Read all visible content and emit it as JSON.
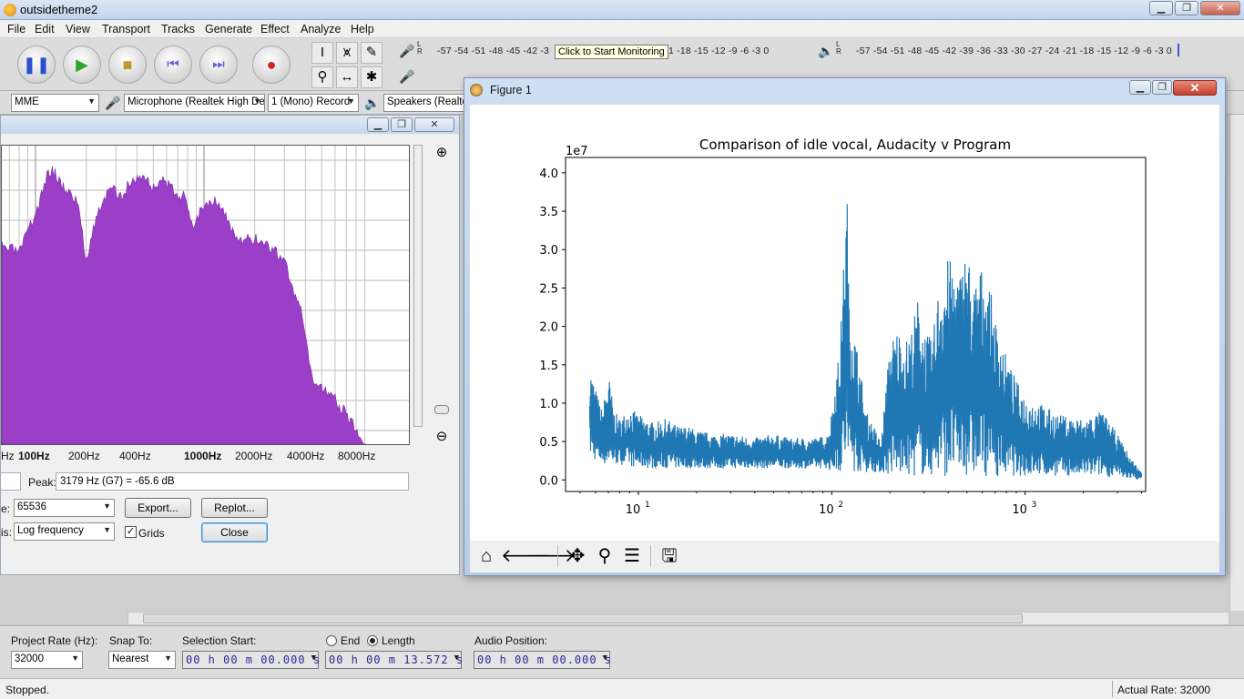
{
  "window": {
    "title": "outsidetheme2"
  },
  "menu": [
    "File",
    "Edit",
    "View",
    "Transport",
    "Tracks",
    "Generate",
    "Effect",
    "Analyze",
    "Help"
  ],
  "meters": {
    "record_scale": "-57 -54 -51 -48 -45 -42 -3",
    "record_scale_tail": "21 -18 -15 -12  -9  -6  -3  0",
    "playback_scale": "-57 -54 -51 -48 -45 -42 -39 -36 -33 -30 -27 -24 -21 -18 -15 -12  -9  -6  -3  0",
    "record_lr": "L\nR",
    "tooltip": "Click to Start Monitoring"
  },
  "devices": {
    "host": "MME",
    "input": "Microphone (Realtek High De",
    "channels": "1 (Mono) Record",
    "output": "Speakers (Realte"
  },
  "spectrum": {
    "x_ticks": [
      "Hz",
      "100Hz",
      "200Hz",
      "400Hz",
      "1000Hz",
      "2000Hz",
      "4000Hz",
      "8000Hz"
    ],
    "peak_label": "Peak:",
    "peak_value": "3179 Hz (G7) = -65.6 dB",
    "size_label": "e:",
    "size_value": "65536",
    "axis_label": "is:",
    "axis_value": "Log frequency",
    "export_label": "Export...",
    "replot_label": "Replot...",
    "grids_label": "Grids",
    "grids_checked": "✓",
    "close_label": "Close",
    "fill_color": "#9b3fc8"
  },
  "figure": {
    "title": "Figure 1",
    "close_glyph": "✕"
  },
  "chart_data": {
    "type": "line",
    "title": "Comparison of idle vocal, Audacity v Program",
    "offset_label": "1e7",
    "xscale": "log",
    "xlim": [
      4.2,
      4200
    ],
    "ylim": [
      -0.15,
      4.2
    ],
    "x_tick_values": [
      10,
      100,
      1000
    ],
    "x_tick_bases": [
      "10",
      "10",
      "10"
    ],
    "x_tick_exps": [
      "1",
      "2",
      "3"
    ],
    "y_ticks": [
      "0.0",
      "0.5",
      "1.0",
      "1.5",
      "2.0",
      "2.5",
      "3.0",
      "3.5",
      "4.0"
    ],
    "y_tick_values": [
      0.0,
      0.5,
      1.0,
      1.5,
      2.0,
      2.5,
      3.0,
      3.5,
      4.0
    ],
    "line_color": "#1f77b4",
    "series": [
      {
        "x": [
          5.6,
          6.0,
          6.5,
          7.0,
          7.5,
          8,
          9,
          10,
          11,
          12,
          14,
          16,
          18,
          20,
          25,
          30,
          40,
          50,
          60,
          70,
          85,
          95,
          100,
          105,
          110,
          115,
          118,
          120,
          122,
          125,
          130,
          140,
          150,
          165,
          180,
          200,
          220,
          240,
          260,
          280,
          300,
          330,
          360,
          400,
          430,
          460,
          500,
          540,
          580,
          620,
          660,
          700,
          750,
          800,
          900,
          1000,
          1200,
          1500,
          2000,
          2500,
          3000,
          3500,
          4000
        ],
        "upper": [
          1.5,
          1.2,
          0.9,
          1.4,
          0.9,
          0.8,
          0.95,
          0.85,
          0.8,
          0.75,
          0.8,
          0.7,
          0.7,
          0.65,
          0.6,
          0.6,
          0.55,
          0.6,
          0.55,
          0.55,
          0.55,
          0.6,
          0.9,
          1.4,
          1.7,
          2.8,
          3.3,
          4.0,
          2.6,
          2.3,
          2.0,
          1.5,
          0.9,
          0.7,
          0.5,
          1.8,
          2.0,
          1.8,
          2.0,
          2.4,
          2.0,
          1.8,
          2.6,
          2.9,
          2.8,
          2.7,
          3.1,
          2.5,
          2.8,
          2.7,
          2.5,
          2.1,
          1.9,
          1.6,
          1.3,
          1.1,
          1.0,
          0.85,
          0.8,
          0.9,
          0.6,
          0.3,
          0.1
        ],
        "lower": [
          0.3,
          0.25,
          0.2,
          0.2,
          0.2,
          0.2,
          0.18,
          0.15,
          0.15,
          0.15,
          0.15,
          0.15,
          0.15,
          0.15,
          0.15,
          0.15,
          0.15,
          0.15,
          0.15,
          0.15,
          0.15,
          0.15,
          0.1,
          0.1,
          0.1,
          0.1,
          0.1,
          0.1,
          0.1,
          0.1,
          0.1,
          0.1,
          0.1,
          0.1,
          0.1,
          0.05,
          0.05,
          0.05,
          0.05,
          0.05,
          0.05,
          0.05,
          0.05,
          0.05,
          0.05,
          0.05,
          0.05,
          0.05,
          0.05,
          0.05,
          0.05,
          0.05,
          0.05,
          0.05,
          0.05,
          0.05,
          0.05,
          0.05,
          0.05,
          0.05,
          0.02,
          0.02,
          0.0
        ]
      }
    ]
  },
  "selection_toolbar": {
    "project_rate_label": "Project Rate (Hz):",
    "project_rate": "32000",
    "snap_label": "Snap To:",
    "snap_value": "Nearest",
    "sel_start_label": "Selection Start:",
    "sel_start": "00 h 00 m 00.000 s",
    "end_label": "End",
    "length_label": "Length",
    "length_value": "00 h 00 m 13.572 s",
    "audio_pos_label": "Audio Position:",
    "audio_pos": "00 h 00 m 00.000 s"
  },
  "status": {
    "left": "Stopped.",
    "right": "Actual Rate: 32000"
  }
}
